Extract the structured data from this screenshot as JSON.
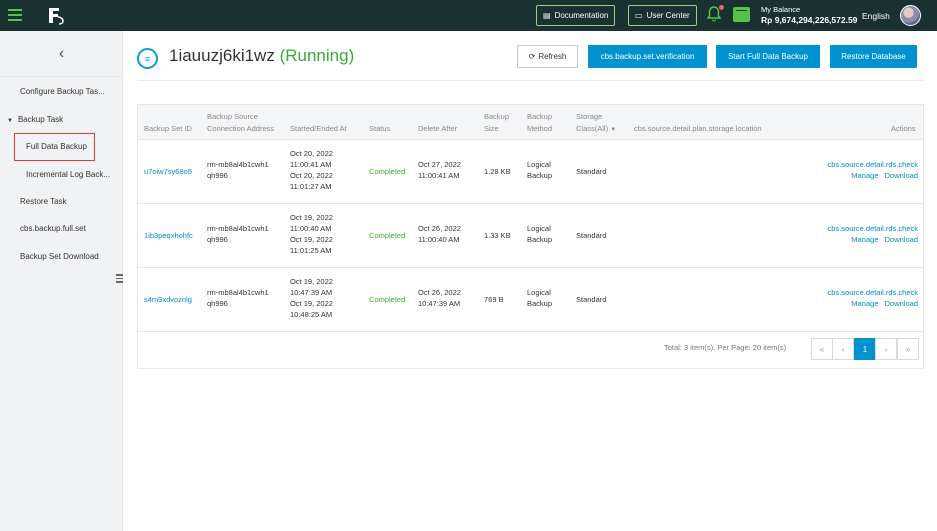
{
  "topbar": {
    "documentation": "Documentation",
    "user_center": "User Center",
    "balance_label": "My Balance",
    "balance_amount": "Rp 9,674,294,226,572.59",
    "language": "English"
  },
  "sidebar": {
    "items": [
      {
        "label": "Configure Backup Tas..."
      },
      {
        "label": "Backup Task"
      },
      {
        "label": "Full Data Backup"
      },
      {
        "label": "Incremental Log Back..."
      },
      {
        "label": "Restore Task"
      },
      {
        "label": "cbs.backup.full.set"
      },
      {
        "label": "Backup Set Download"
      }
    ]
  },
  "header": {
    "instance_id": "1iauuzj6ki1wz",
    "status": "(Running)",
    "refresh": "Refresh",
    "verify": "cbs.backup.set.verification",
    "start_full": "Start Full Data Backup",
    "restore_db": "Restore Database"
  },
  "table": {
    "columns": {
      "set_id": "Backup Set ID",
      "source_1": "Backup Source",
      "source_2": "Connection Address",
      "started": "Started/Ended At",
      "status": "Status",
      "delete_after": "Delete After",
      "size_1": "Backup",
      "size_2": "Size",
      "method_1": "Backup",
      "method_2": "Method",
      "storage_1": "Storage",
      "storage_2": "Class(All)",
      "location": "cbs.source.detail.plan.storage.location",
      "actions": "Actions"
    },
    "rows": [
      {
        "id": "u7oiw7sy68o5",
        "addr_1": "rm-mb8al4b1cwh1",
        "addr_2": "qh996",
        "start_date": "Oct 20, 2022",
        "start_time": "11:00:41 AM",
        "end_date": "Oct 20, 2022",
        "end_time": "11:01:27 AM",
        "status": "Completed",
        "del_date": "Oct 27, 2022",
        "del_time": "11:00:41 AM",
        "size": "1.28 KB",
        "method_1": "Logical",
        "method_2": "Backup",
        "storage": "Standard",
        "check": "cbs.source.detail.rds.check",
        "manage": "Manage",
        "download": "Download"
      },
      {
        "id": "1ib3peqxhohfc",
        "addr_1": "rm-mb8al4b1cwh1",
        "addr_2": "qh996",
        "start_date": "Oct 19, 2022",
        "start_time": "11:00:40 AM",
        "end_date": "Oct 19, 2022",
        "end_time": "11:01:25 AM",
        "status": "Completed",
        "del_date": "Oct 26, 2022",
        "del_time": "11:00:40 AM",
        "size": "1.33 KB",
        "method_1": "Logical",
        "method_2": "Backup",
        "storage": "Standard",
        "check": "cbs.source.detail.rds.check",
        "manage": "Manage",
        "download": "Download"
      },
      {
        "id": "s4m9xdvoznlg",
        "addr_1": "rm-mb8al4b1cwh1",
        "addr_2": "qh996",
        "start_date": "Oct 19, 2022",
        "start_time": "10:47:39 AM",
        "end_date": "Oct 19, 2022",
        "end_time": "10:48:25 AM",
        "status": "Completed",
        "del_date": "Oct 26, 2022",
        "del_time": "10:47:39 AM",
        "size": "769 B",
        "method_1": "Logical",
        "method_2": "Backup",
        "storage": "Standard",
        "check": "cbs.source.detail.rds.check",
        "manage": "Manage",
        "download": "Download"
      }
    ]
  },
  "pagination": {
    "info": "Total: 3 item(s), Per Page: 20 item(s)",
    "first": "«",
    "prev": "‹",
    "current": "1",
    "next": "›",
    "last": "»"
  },
  "colors": {
    "topbar": "#1a3131",
    "accent_green": "#56c247",
    "primary": "#0092d0",
    "link": "#0088cc",
    "running": "#3aa93a",
    "highlight_box": "#e03a3a"
  }
}
